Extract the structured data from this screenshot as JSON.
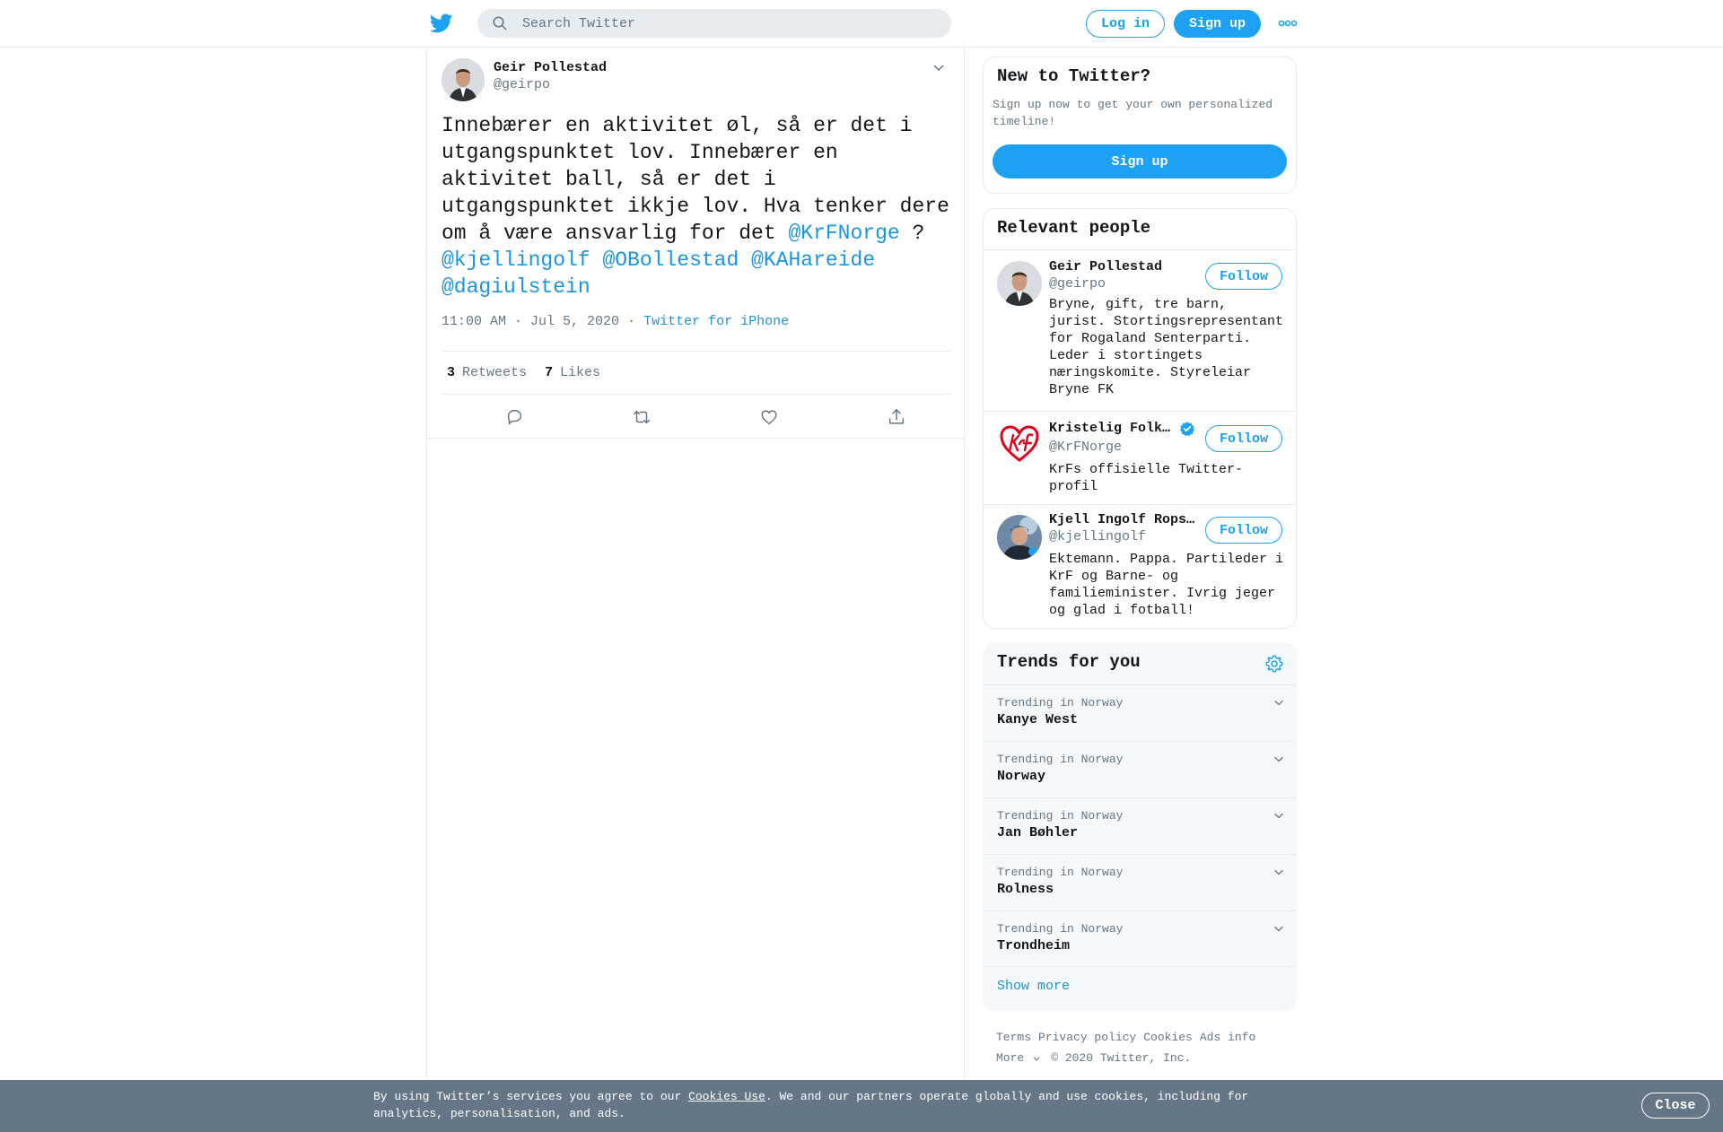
{
  "topbar": {
    "logo_icon": "twitter-bird-icon",
    "search_placeholder": "Search Twitter",
    "login_label": "Log in",
    "signup_label": "Sign up",
    "more_icon": "more-dots-icon"
  },
  "tweet": {
    "author_name": "Geir Pollestad",
    "author_handle": "@geirpo",
    "text_part1": "Innebærer en aktivitet øl, så er det i utgangspunktet lov. Innebærer en aktivitet ball, så er det i utgangspunktet ikkje lov. Hva tenker dere om å være ansvarlig for det ",
    "mention1": "@KrFNorge",
    "text_part2": " ?",
    "mentions_line": [
      "@kjellingolf",
      "@OBollestad",
      "@KAHareide",
      "@dagiulstein"
    ],
    "timestamp": "11:00 AM · Jul 5, 2020",
    "source": "Twitter for iPhone",
    "retweets_count": "3",
    "retweets_label": "Retweets",
    "likes_count": "7",
    "likes_label": "Likes",
    "actions": [
      "reply-icon",
      "retweet-icon",
      "like-icon",
      "share-icon"
    ]
  },
  "sidebar": {
    "new_to_twitter": {
      "title": "New to Twitter?",
      "subtitle": "Sign up now to get your own personalized timeline!",
      "button": "Sign up"
    },
    "relevant_people": {
      "title": "Relevant people",
      "people": [
        {
          "name": "Geir Pollestad",
          "handle": "@geirpo",
          "bio": "Bryne, gift, tre barn, jurist. Stortingsrepresentant for Rogaland Senterparti. Leder i stortingets næringskomite. Styreleiar Bryne FK",
          "follow": "Follow",
          "verified": false
        },
        {
          "name": "Kristelig Folk…",
          "handle": "@KrFNorge",
          "bio": "KrFs offisielle Twitter-profil",
          "follow": "Follow",
          "verified": true
        },
        {
          "name": "Kjell Ingolf Rops…",
          "handle": "@kjellingolf",
          "bio": "Ektemann. Pappa. Partileder i KrF og Barne- og familieminister. Ivrig jeger og glad i fotball!",
          "follow": "Follow",
          "verified": false
        }
      ]
    },
    "trends": {
      "title": "Trends for you",
      "items": [
        {
          "context": "Trending in Norway",
          "name": "Kanye West"
        },
        {
          "context": "Trending in Norway",
          "name": "Norway"
        },
        {
          "context": "Trending in Norway",
          "name": "Jan Bøhler"
        },
        {
          "context": "Trending in Norway",
          "name": "Rolness"
        },
        {
          "context": "Trending in Norway",
          "name": "Trondheim"
        }
      ],
      "show_more": "Show more"
    },
    "footer": {
      "links": [
        "Terms",
        "Privacy policy",
        "Cookies",
        "Ads info"
      ],
      "more": "More",
      "copyright": "© 2020 Twitter, Inc."
    }
  },
  "cookie_banner": {
    "text_before": "By using Twitter’s services you agree to our ",
    "link": "Cookies Use",
    "text_after": ". We and our partners operate globally and use cookies, including for analytics, personalisation, and ads.",
    "close": "Close"
  },
  "colors": {
    "brand_blue": "#1da1f2",
    "link_blue": "#1b95e0",
    "muted_text": "#657786",
    "banner_bg": "#657786"
  }
}
